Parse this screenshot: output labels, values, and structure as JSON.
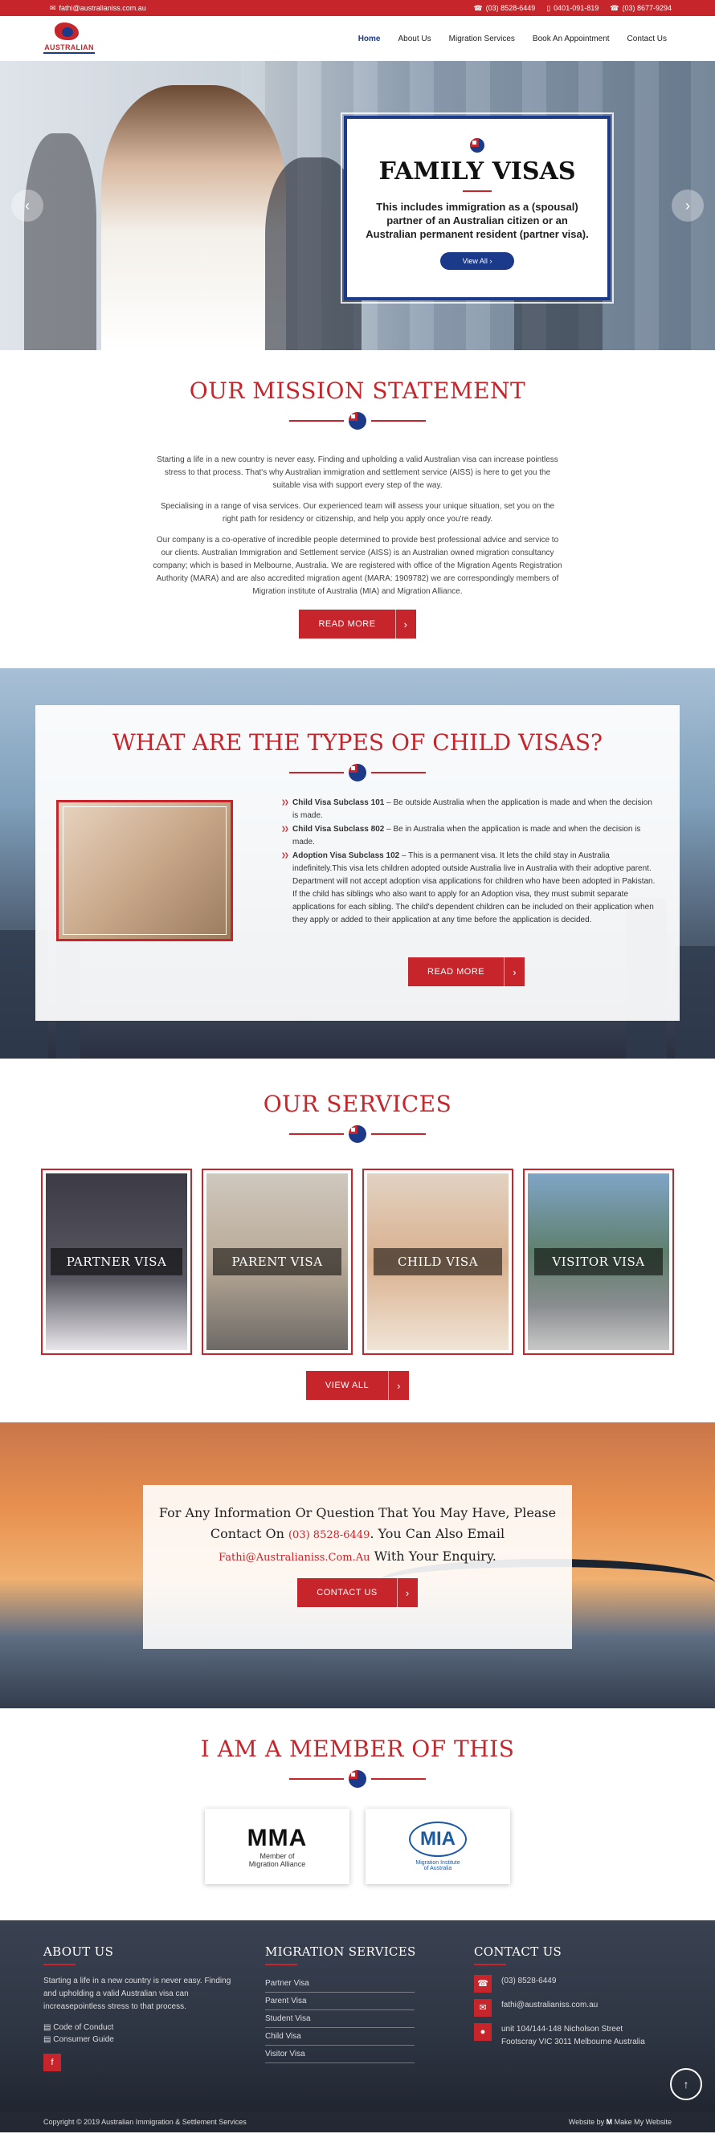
{
  "topbar": {
    "email": "fathi@australianiss.com.au",
    "phone1": "(03) 8528-6449",
    "phone2": "0401-091-819",
    "phone3": "(03) 8677-9294"
  },
  "brand": {
    "name": "AUSTRALIAN"
  },
  "nav": {
    "home": "Home",
    "about": "About Us",
    "migration": "Migration Services",
    "book": "Book An Appointment",
    "contact": "Contact Us"
  },
  "hero": {
    "title": "FAMILY VISAS",
    "text": "This includes immigration as a (spousal) partner of an Australian citizen or an Australian permanent resident (partner visa).",
    "button": "View All",
    "prev_arrow": "‹",
    "next_arrow": "›"
  },
  "mission": {
    "heading": "OUR MISSION STATEMENT",
    "p1": "Starting a life in a new country is never easy. Finding and upholding a valid Australian visa can increase pointless stress to that process. That's why Australian immigration and settlement service (AISS) is here to get you the suitable visa with support every step of the way.",
    "p2": "Specialising in a range of visa services. Our experienced team will assess your unique situation, set you on the right path for residency or citizenship, and help you apply once you're ready.",
    "p3": "Our company is a co-operative of incredible people determined to provide best professional advice and service to our clients. Australian Immigration and Settlement service (AISS) is an Australian owned migration consultancy company; which is based in Melbourne, Australia. We are registered with office of the Migration Agents Registration Authority (MARA) and are also accredited migration agent (MARA: 1909782) we are correspondingly members of Migration institute of Australia (MIA) and Migration Alliance.",
    "button": "READ MORE"
  },
  "child_visas": {
    "heading": "WHAT ARE THE TYPES OF CHILD VISAS?",
    "items": [
      {
        "bold": "Child Visa Subclass 101",
        "text": " – Be outside Australia when the application is made and when the decision is made."
      },
      {
        "bold": "Child Visa Subclass 802",
        "text": " – Be in Australia when the application is made and when the decision is made."
      },
      {
        "bold": "Adoption Visa Subclass 102",
        "text": " – This is a permanent visa. It lets the child stay in Australia indefinitely.This visa lets children adopted outside Australia live in Australia with their adoptive parent. Department will not accept adoption visa applications for children who have been adopted in Pakistan. If the child has siblings who also want to apply for an Adoption visa, they must submit separate applications for each sibling. The child's dependent children can be included on their application when they apply or added to their application at any time before the application is decided."
      }
    ],
    "button": "READ MORE"
  },
  "services": {
    "heading": "OUR SERVICES",
    "cards": [
      "PARTNER VISA",
      "PARENT VISA",
      "CHILD VISA",
      "VISITOR VISA"
    ],
    "button": "VIEW ALL"
  },
  "contact_banner": {
    "line1": "For Any Information Or Question That You May Have, Please",
    "line2a": "Contact On ",
    "phone": "(03) 8528-6449",
    "line2b": ". You Can Also Email",
    "email": "Fathi@Australianiss.Com.Au",
    "line3b": " With Your Enquiry.",
    "button": "CONTACT US"
  },
  "member": {
    "heading": "I AM A MEMBER OF THIS",
    "mma_logo": "MMA",
    "mma_sub1": "Member of",
    "mma_sub2": "Migration Alliance",
    "mia_logo": "MIA",
    "mia_sub1": "Migration Institute",
    "mia_sub2": "of Australia"
  },
  "footer": {
    "about_heading": "ABOUT US",
    "about_text": "Starting a life in a new country is never easy. Finding and upholding a valid Australian visa can increasepointless stress to that process.",
    "code": "Code of Conduct",
    "guide": "Consumer Guide",
    "fb": "f",
    "services_heading": "MIGRATION SERVICES",
    "services": [
      "Partner Visa",
      "Parent Visa",
      "Student Visa",
      "Child Visa",
      "Visitor Visa"
    ],
    "contact_heading": "CONTACT US",
    "phone": "(03) 8528-6449",
    "email": "fathi@australianiss.com.au",
    "address1": "unit 104/144-148 Nicholson Street",
    "address2": "Footscray VIC 3011 Melbourne Australia",
    "copyright": "Copyright © 2019 Australian Immigration & Settlement Services",
    "website_by": "Website by",
    "maker": "Make My Website",
    "to_top": "↑"
  },
  "colors": {
    "accent": "#c6262b",
    "navy": "#1b3a8a"
  }
}
